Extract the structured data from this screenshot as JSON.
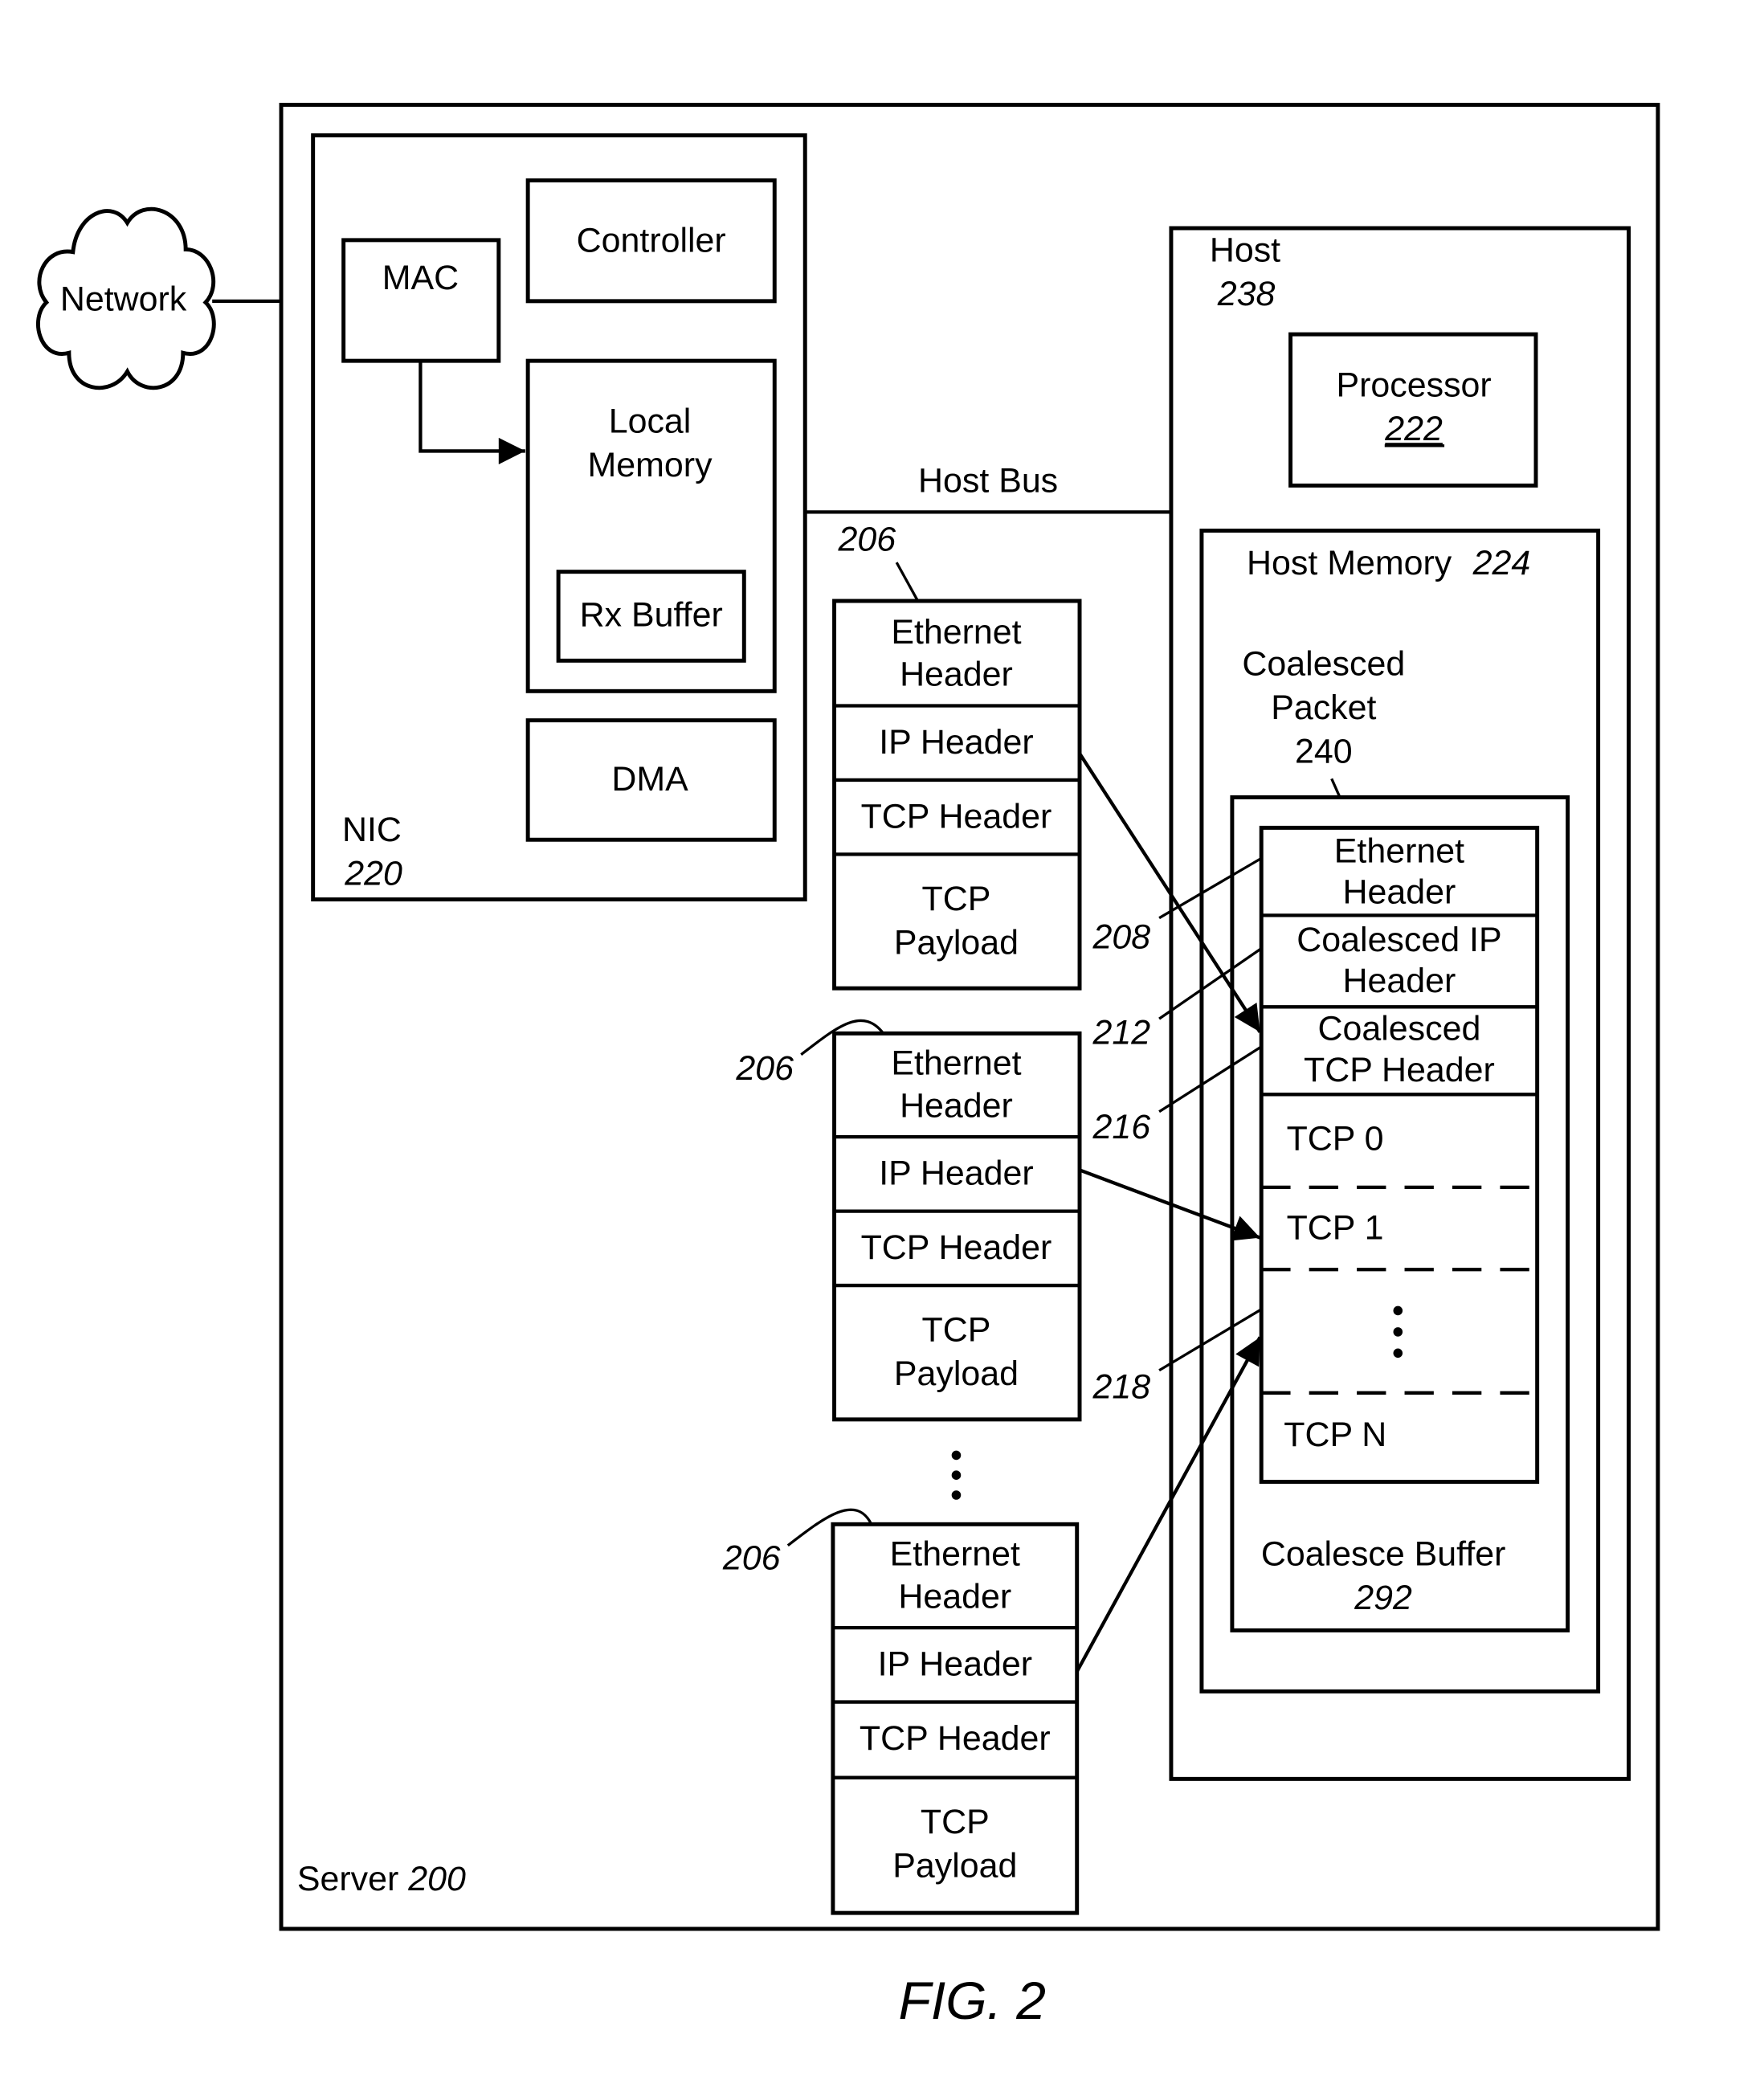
{
  "figure": {
    "caption": "FIG. 2"
  },
  "network": {
    "label": "Network"
  },
  "server": {
    "label": "Server",
    "ref": "200"
  },
  "nic": {
    "label": "NIC",
    "ref": "220",
    "mac": "MAC",
    "controller": "Controller",
    "local_memory_line1": "Local",
    "local_memory_line2": "Memory",
    "rx_buffer": "Rx Buffer",
    "dma": "DMA"
  },
  "host_bus": {
    "label": "Host Bus"
  },
  "host": {
    "label": "Host",
    "ref": "238",
    "processor": "Processor",
    "processor_ref": "222",
    "memory_label": "Host Memory",
    "memory_ref": "224",
    "coalesced_packet_line1": "Coalesced",
    "coalesced_packet_line2": "Packet",
    "coalesced_packet_ref": "240",
    "coalesce_buffer_label": "Coalesce Buffer",
    "coalesce_buffer_ref": "292"
  },
  "coalesced_packet": {
    "eth_line1": "Ethernet",
    "eth_line2": "Header",
    "ip_line1": "Coalesced IP",
    "ip_line2": "Header",
    "tcp_line1": "Coalesced",
    "tcp_line2": "TCP Header",
    "segments": [
      "TCP 0",
      "TCP 1",
      "TCP N"
    ],
    "ellipsis": "⋮"
  },
  "packet_template": {
    "ref": "206",
    "eth_line1": "Ethernet",
    "eth_line2": "Header",
    "ip": "IP Header",
    "tcp": "TCP Header",
    "payload_line1": "TCP",
    "payload_line2": "Payload"
  },
  "reference_labels": {
    "r208": "208",
    "r212": "212",
    "r216": "216",
    "r218": "218"
  }
}
